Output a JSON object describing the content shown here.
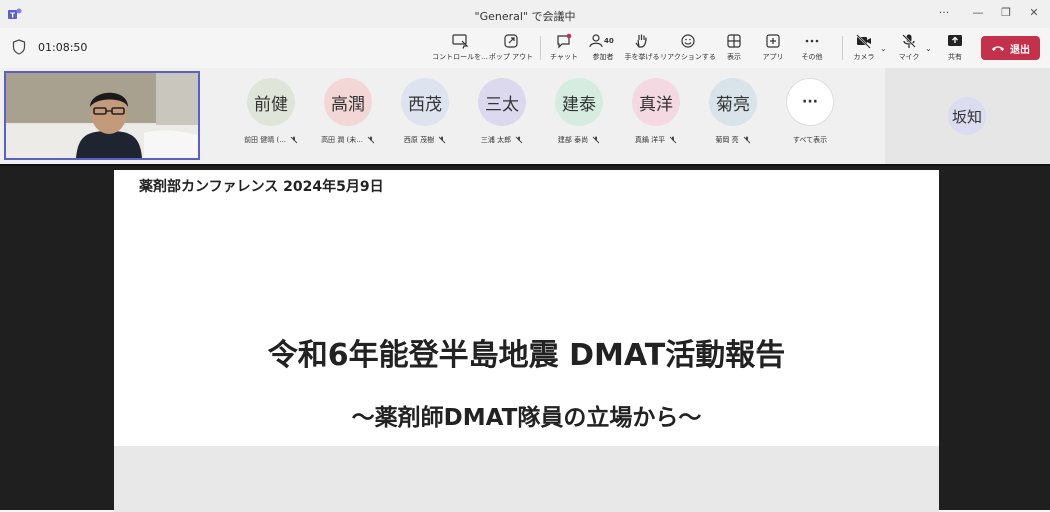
{
  "window": {
    "title": "\"General\" で会議中",
    "controls": [
      "···",
      "—",
      "❐",
      "✕"
    ]
  },
  "toolbar": {
    "timer": "01:08:50",
    "buttons": [
      {
        "label": "コントロールを...",
        "icon": "control-icon"
      },
      {
        "label": "ポップ アウト",
        "icon": "popout-icon"
      },
      {
        "label": "チャット",
        "icon": "chat-icon"
      },
      {
        "label": "参加者",
        "icon": "people-icon",
        "count": "40"
      },
      {
        "label": "手を挙げる",
        "icon": "hand-icon"
      },
      {
        "label": "リアクションする",
        "icon": "reaction-icon"
      },
      {
        "label": "表示",
        "icon": "view-icon"
      },
      {
        "label": "アプリ",
        "icon": "apps-icon"
      },
      {
        "label": "その他",
        "icon": "more-icon"
      },
      {
        "label": "カメラ",
        "icon": "camera-off-icon"
      },
      {
        "label": "マイク",
        "icon": "mic-off-icon"
      },
      {
        "label": "共有",
        "icon": "share-icon"
      }
    ],
    "leave_label": "退出",
    "leave_color": "#c4314b"
  },
  "participants": [
    {
      "initials": "前健",
      "name": "前田 健晴 (...",
      "color": "#dfe6d9"
    },
    {
      "initials": "高潤",
      "name": "高田 潤 (未...",
      "color": "#f3d6d6"
    },
    {
      "initials": "西茂",
      "name": "西原 茂樹",
      "color": "#dde3ef"
    },
    {
      "initials": "三太",
      "name": "三浦 太郎",
      "color": "#dcd8ee"
    },
    {
      "initials": "建泰",
      "name": "建部 泰尚",
      "color": "#d6ece0"
    },
    {
      "initials": "真洋",
      "name": "真鍋 洋平",
      "color": "#f4d9e2"
    },
    {
      "initials": "菊亮",
      "name": "菊岡 亮",
      "color": "#d9e3ea"
    }
  ],
  "show_all_label": "すべて表示",
  "right_participant": {
    "initials": "坂知"
  },
  "slide": {
    "conference": "薬剤部カンファレンス 2024年5月9日",
    "title": "令和6年能登半島地震 DMAT活動報告",
    "subtitle": "～薬剤師DMAT隊員の立場から～"
  }
}
